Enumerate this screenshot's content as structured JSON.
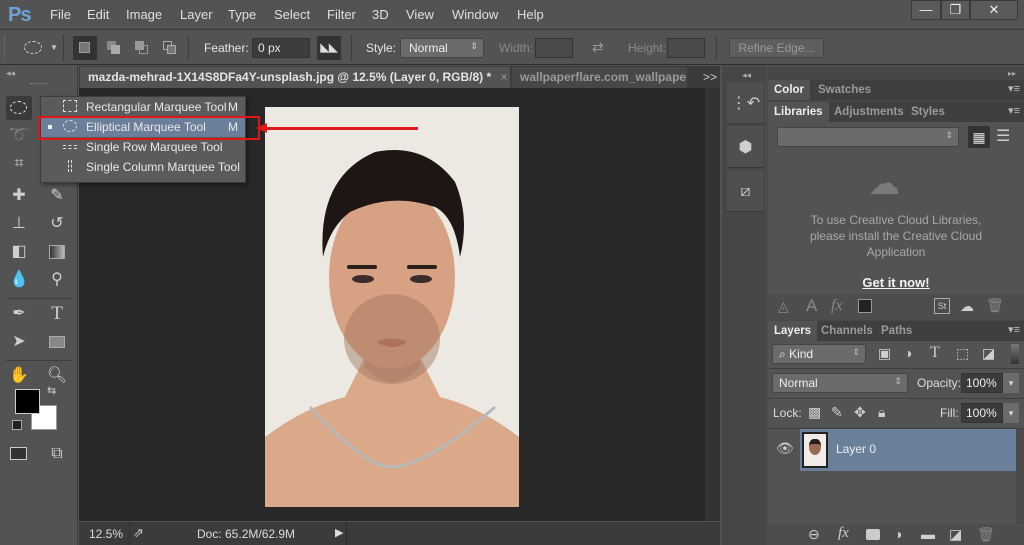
{
  "app": {
    "logo": "Ps"
  },
  "menu": [
    "File",
    "Edit",
    "Image",
    "Layer",
    "Type",
    "Select",
    "Filter",
    "3D",
    "View",
    "Window",
    "Help"
  ],
  "window_controls": {
    "minimize": "—",
    "restore": "❐",
    "close": "✕"
  },
  "options_bar": {
    "feather_label": "Feather:",
    "feather_value": "0 px",
    "style_label": "Style:",
    "style_value": "Normal",
    "width_label": "Width:",
    "height_label": "Height:",
    "refine_edge_label": "Refine Edge..."
  },
  "document_tabs": [
    {
      "label": "mazda-mehrad-1X14S8DFa4Y-unsplash.jpg @ 12.5% (Layer 0, RGB/8) *",
      "close": "×",
      "active": true
    },
    {
      "label": "wallpaperflare.com_wallpape",
      "active": false
    }
  ],
  "tabs_overflow": ">>",
  "flyout": {
    "items": [
      {
        "label": "Rectangular Marquee Tool",
        "shortcut": "M",
        "icon": "rect-marquee-icon",
        "selected": false
      },
      {
        "label": "Elliptical Marquee Tool",
        "shortcut": "M",
        "icon": "ellipse-marquee-icon",
        "selected": true
      },
      {
        "label": "Single Row Marquee Tool",
        "shortcut": "",
        "icon": "single-row-marquee-icon",
        "selected": false
      },
      {
        "label": "Single Column Marquee Tool",
        "shortcut": "",
        "icon": "single-column-marquee-icon",
        "selected": false
      }
    ]
  },
  "annotation": {
    "highlight_color": "#e01717"
  },
  "status_bar": {
    "zoom": "12.5%",
    "doc": "Doc: 65.2M/62.9M",
    "more": "▶"
  },
  "color_panel": {
    "tabs": [
      "Color",
      "Swatches"
    ],
    "active": "Color"
  },
  "libraries_panel": {
    "tabs": [
      "Libraries",
      "Adjustments",
      "Styles"
    ],
    "active": "Libraries",
    "message": "To use Creative Cloud Libraries, please install the Creative Cloud Application",
    "link": "Get it now!"
  },
  "layers_panel": {
    "tabs": [
      "Layers",
      "Channels",
      "Paths"
    ],
    "active": "Layers",
    "filter_kind": "Kind",
    "blend_mode": "Normal",
    "opacity_label": "Opacity:",
    "opacity_value": "100%",
    "lock_label": "Lock:",
    "fill_label": "Fill:",
    "fill_value": "100%",
    "layers": [
      {
        "name": "Layer 0",
        "visible": true,
        "selected": true
      }
    ]
  },
  "colors": {
    "accent": "#6b7f9b",
    "selected_layer": "#6a7f99",
    "ps_blue": "#6fa3d8"
  }
}
